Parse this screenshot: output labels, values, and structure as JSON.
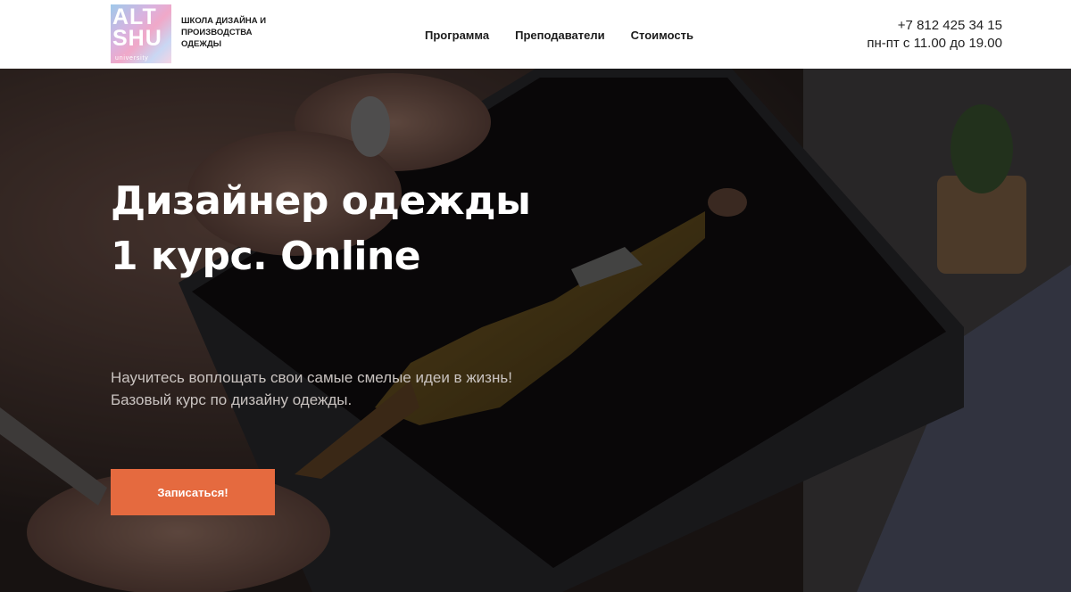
{
  "header": {
    "logo": {
      "mark_line1": "ALT",
      "mark_line2": "SHU",
      "sub": "university"
    },
    "logo_text": "Школа дизайна и производства одежды",
    "nav": [
      {
        "label": "Программа"
      },
      {
        "label": "Преподаватели"
      },
      {
        "label": "Стоимость"
      }
    ],
    "contacts": {
      "phone": "+7 812 425 34 15",
      "hours": "пн-пт с 11.00 до 19.00"
    }
  },
  "hero": {
    "title_line1": "Дизайнер одежды",
    "title_line2": "1 курс. Online",
    "desc_line1": "Научитесь воплощать свои самые смелые идеи в жизнь!",
    "desc_line2": "Базовый курс по дизайну одежды.",
    "cta_label": "Записаться!"
  },
  "colors": {
    "accent": "#e56a3f",
    "header_bg": "#ffffff",
    "text_dark": "#1c1c1c"
  }
}
